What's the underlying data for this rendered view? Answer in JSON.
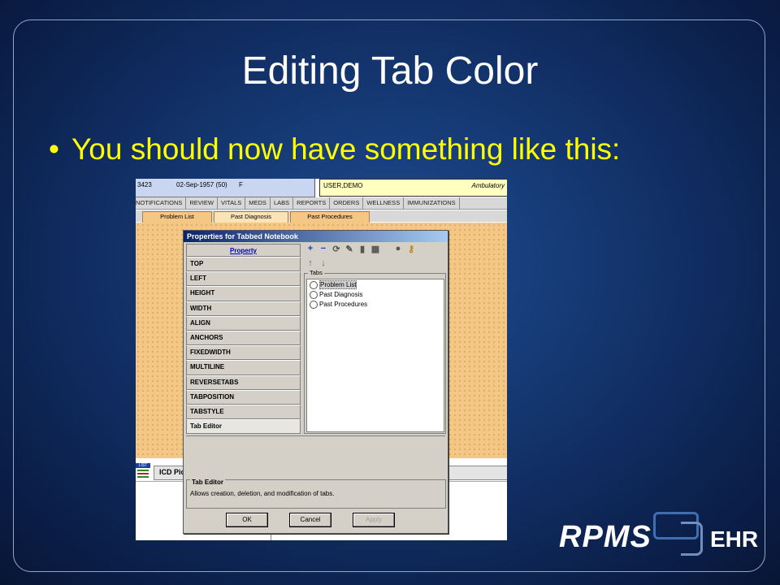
{
  "slide": {
    "title": "Editing Tab Color",
    "bullet": "You should now have something like this:"
  },
  "screenshot": {
    "header_left": {
      "id": "3423",
      "dob": "02-Sep-1957 (50)",
      "sex": "F"
    },
    "header_right": {
      "name": "USER,DEMO",
      "clinic": "Ambulatory"
    },
    "main_tabs": [
      "NOTIFICATIONS",
      "REVIEW",
      "VITALS",
      "MEDS",
      "LABS",
      "REPORTS",
      "ORDERS",
      "WELLNESS",
      "IMMUNIZATIONS"
    ],
    "notebook_tabs": [
      "Problem List",
      "Past Diagnosis",
      "Past Procedures"
    ],
    "list_icon_label": "LIST",
    "icd_label": "ICD Pic",
    "dialog": {
      "title": "Properties for Tabbed Notebook",
      "property_header": "Property",
      "properties": [
        "TOP",
        "LEFT",
        "HEIGHT",
        "WIDTH",
        "ALIGN",
        "ANCHORS",
        "FIXEDWIDTH",
        "MULTILINE",
        "REVERSETABS",
        "TABPOSITION",
        "TABSTYLE",
        "Tab Editor"
      ],
      "tabs_group_label": "Tabs",
      "tabs_list": [
        "Problem List",
        "Past Diagnosis",
        "Past Procedures"
      ],
      "editor_title": "Tab Editor",
      "editor_desc": "Allows creation, deletion, and modification of tabs.",
      "buttons": {
        "ok": "OK",
        "cancel": "Cancel",
        "apply": "Apply"
      }
    }
  },
  "logo": {
    "brand": "RPMS",
    "suffix": "EHR"
  },
  "colors": {
    "title": "#ffffff",
    "bullet": "#ffff00",
    "notebook": "#f5c784",
    "dialog_title": "#0a246a"
  }
}
